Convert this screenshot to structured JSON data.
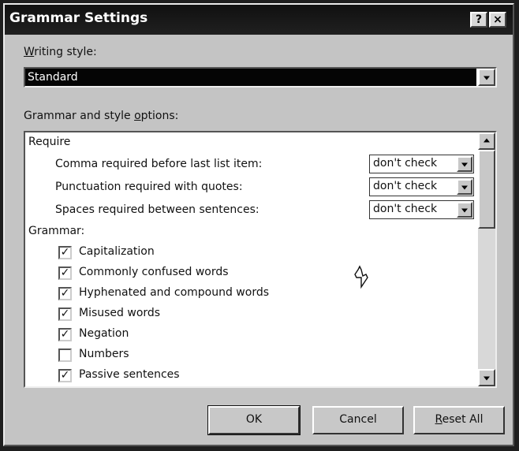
{
  "window": {
    "title": "Grammar Settings",
    "help_label": "?",
    "close_label": "×"
  },
  "writing_style": {
    "label_underlined": "W",
    "label_rest": "riting style:",
    "selected": "Standard"
  },
  "options": {
    "label_before": "Grammar and style ",
    "label_underlined": "o",
    "label_after": "ptions:",
    "require_heading": "Require",
    "require_items": [
      {
        "label": "Comma required before last list item:",
        "value": "don't check"
      },
      {
        "label": "Punctuation required with quotes:",
        "value": "don't check"
      },
      {
        "label": "Spaces required between sentences:",
        "value": "don't check"
      }
    ],
    "grammar_heading": "Grammar:",
    "grammar_items": [
      {
        "label": "Capitalization",
        "check": "✓"
      },
      {
        "label": "Commonly confused words",
        "check": "✓"
      },
      {
        "label": "Hyphenated and compound words",
        "check": "✓"
      },
      {
        "label": "Misused words",
        "check": "✓"
      },
      {
        "label": "Negation",
        "check": "✓"
      },
      {
        "label": "Numbers",
        "check": ""
      },
      {
        "label": "Passive sentences",
        "check": "✓"
      }
    ]
  },
  "buttons": {
    "ok": "OK",
    "cancel": "Cancel",
    "reset_underlined": "R",
    "reset_rest": "eset All"
  }
}
